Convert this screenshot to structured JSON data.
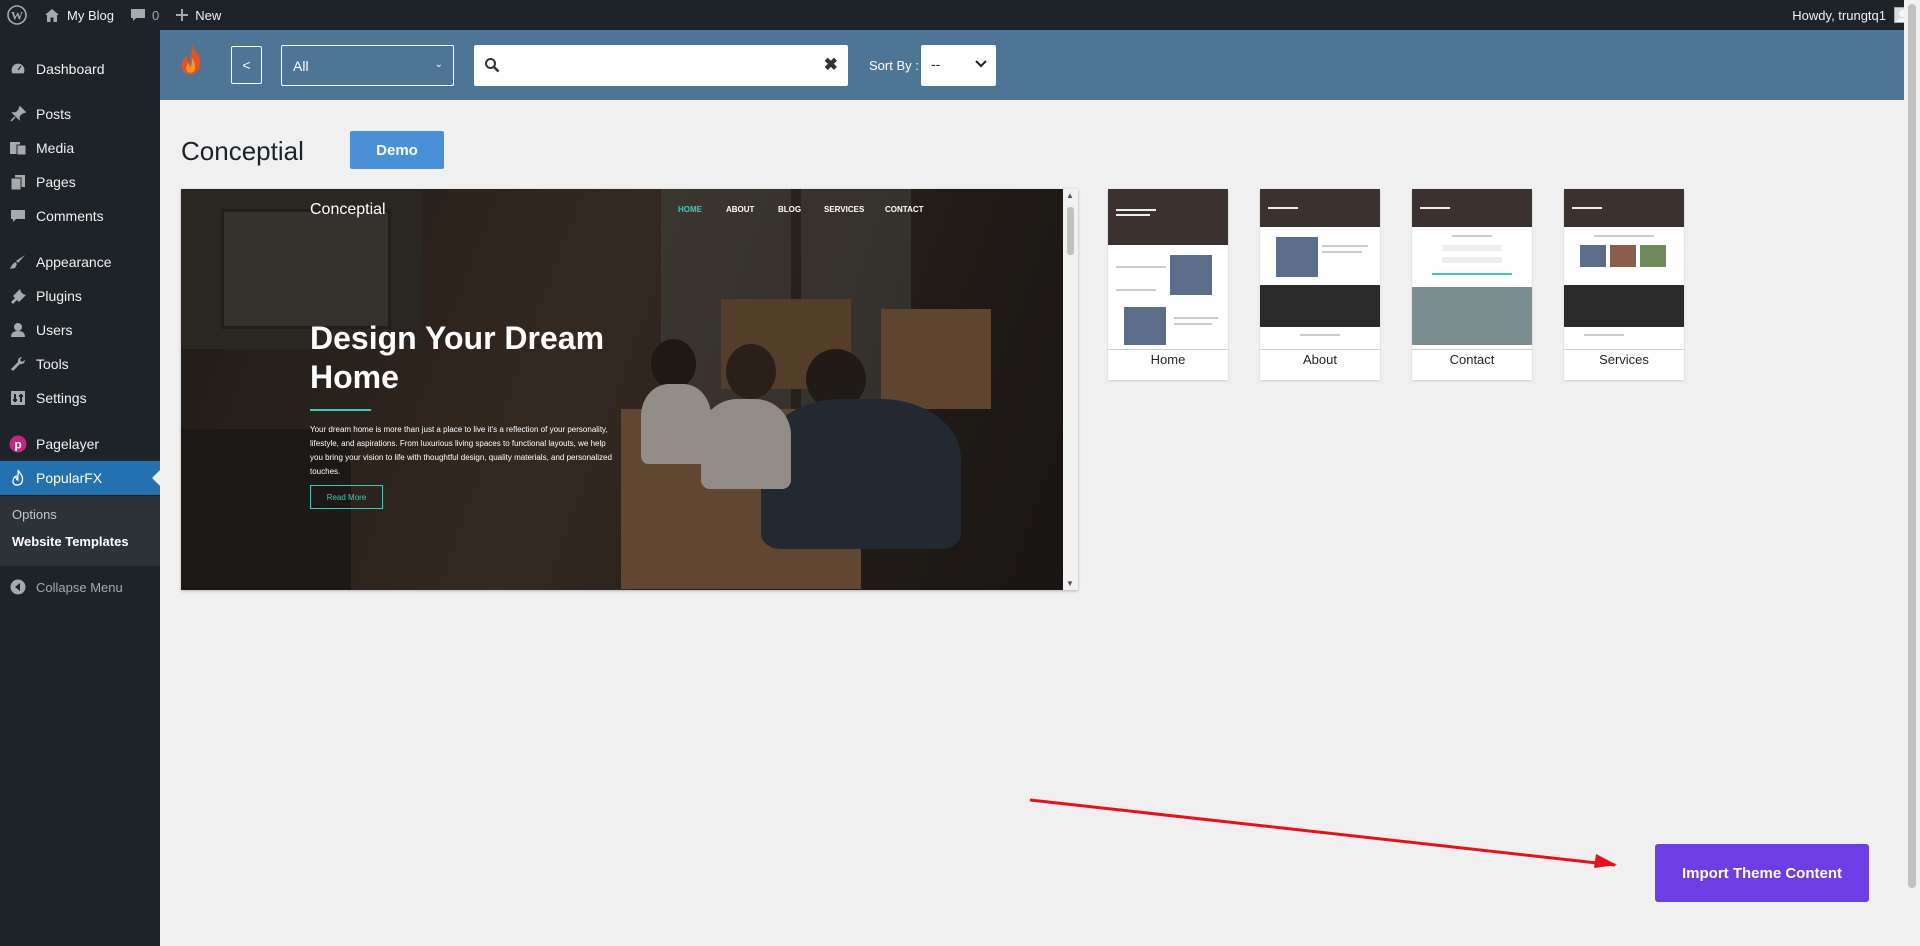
{
  "adminbar": {
    "site_name": "My Blog",
    "comments_count": "0",
    "new_label": "New",
    "howdy": "Howdy, trungtq1"
  },
  "sidebar": {
    "items": [
      {
        "label": "Dashboard",
        "icon": "dashboard-icon"
      },
      {
        "label": "Posts",
        "icon": "pin-icon"
      },
      {
        "label": "Media",
        "icon": "media-icon"
      },
      {
        "label": "Pages",
        "icon": "pages-icon"
      },
      {
        "label": "Comments",
        "icon": "comment-icon"
      },
      {
        "label": "Appearance",
        "icon": "brush-icon"
      },
      {
        "label": "Plugins",
        "icon": "plugin-icon"
      },
      {
        "label": "Users",
        "icon": "user-icon"
      },
      {
        "label": "Tools",
        "icon": "wrench-icon"
      },
      {
        "label": "Settings",
        "icon": "settings-icon"
      },
      {
        "label": "Pagelayer",
        "icon": "pagelayer-icon"
      },
      {
        "label": "PopularFX",
        "icon": "popularfx-icon"
      }
    ],
    "submenu": [
      "Options",
      "Website Templates"
    ],
    "collapse_label": "Collapse Menu"
  },
  "toolbar": {
    "back_label": "<",
    "category_value": "All",
    "search_value": "",
    "sort_label": "Sort By :",
    "sort_value": "--"
  },
  "template": {
    "name": "Conceptial",
    "demo_label": "Demo",
    "preview": {
      "brand": "Conceptial",
      "nav": [
        "HOME",
        "ABOUT",
        "BLOG",
        "SERVICES",
        "CONTACT"
      ],
      "headline": "Design Your Dream Home",
      "paragraph": "Your dream home is more than just a place to live it's a reflection of your personality, lifestyle, and aspirations. From luxurious living spaces to functional layouts, we help you bring your vision to life with thoughtful design, quality materials, and personalized touches.",
      "button": "Read More"
    },
    "pages": [
      "Home",
      "About",
      "Contact",
      "Services"
    ]
  },
  "import_label": "Import Theme Content",
  "colors": {
    "toolbar": "#4f7596",
    "sidebar": "#1d2327",
    "current_menu": "#2271b1",
    "demo_button": "#4a90d9",
    "import_button": "#6b3ee6",
    "annotation_arrow": "#e8111b"
  }
}
